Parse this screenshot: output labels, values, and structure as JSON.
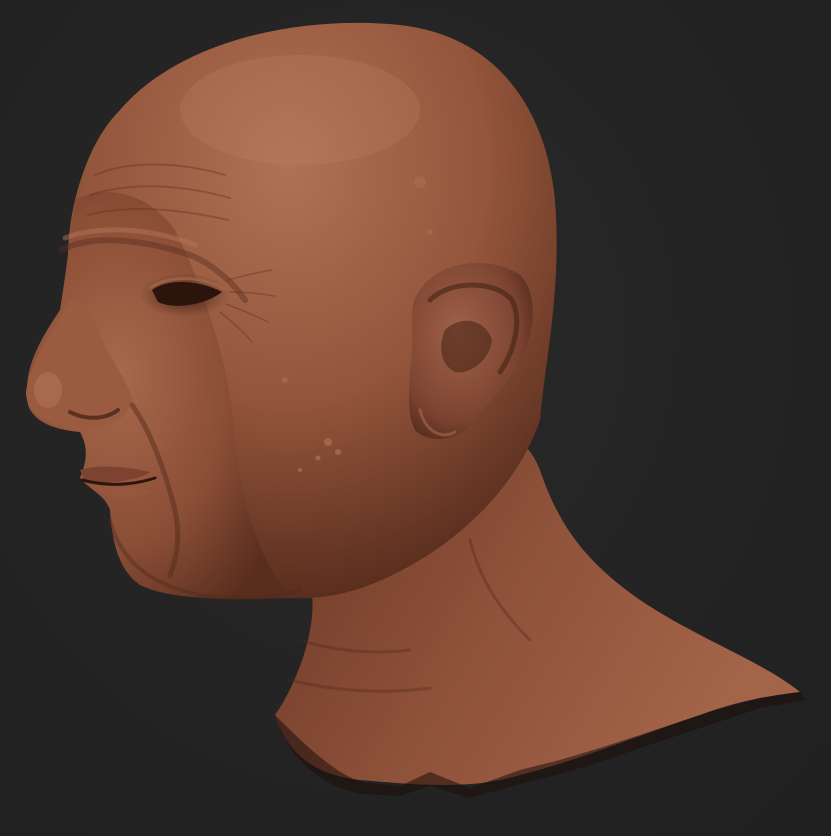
{
  "scene": {
    "subject": "sculpted-head-bust",
    "view": "left-profile",
    "colors": {
      "background": "#232323",
      "clay_base": "#8a4e36",
      "clay_highlight": "#b07256",
      "clay_shadow": "#4a2618"
    }
  }
}
